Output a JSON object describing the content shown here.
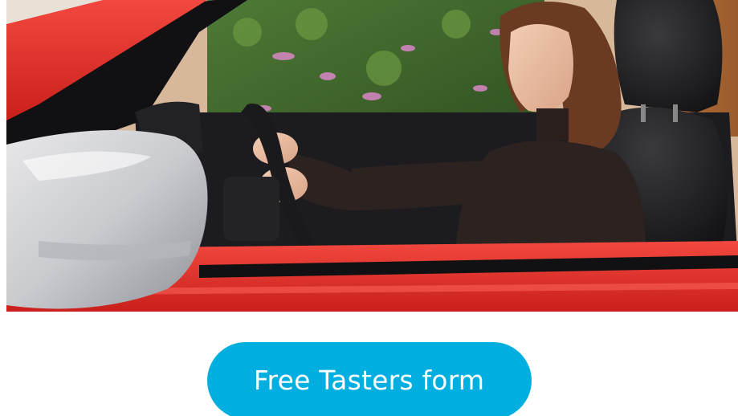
{
  "hero": {
    "image_name": "woman-driving-red-car-photo"
  },
  "cta": {
    "label": "Free Tasters form"
  },
  "colors": {
    "cta_background": "#00aee0",
    "cta_text": "#ffffff",
    "car_body": "#e4312b"
  }
}
